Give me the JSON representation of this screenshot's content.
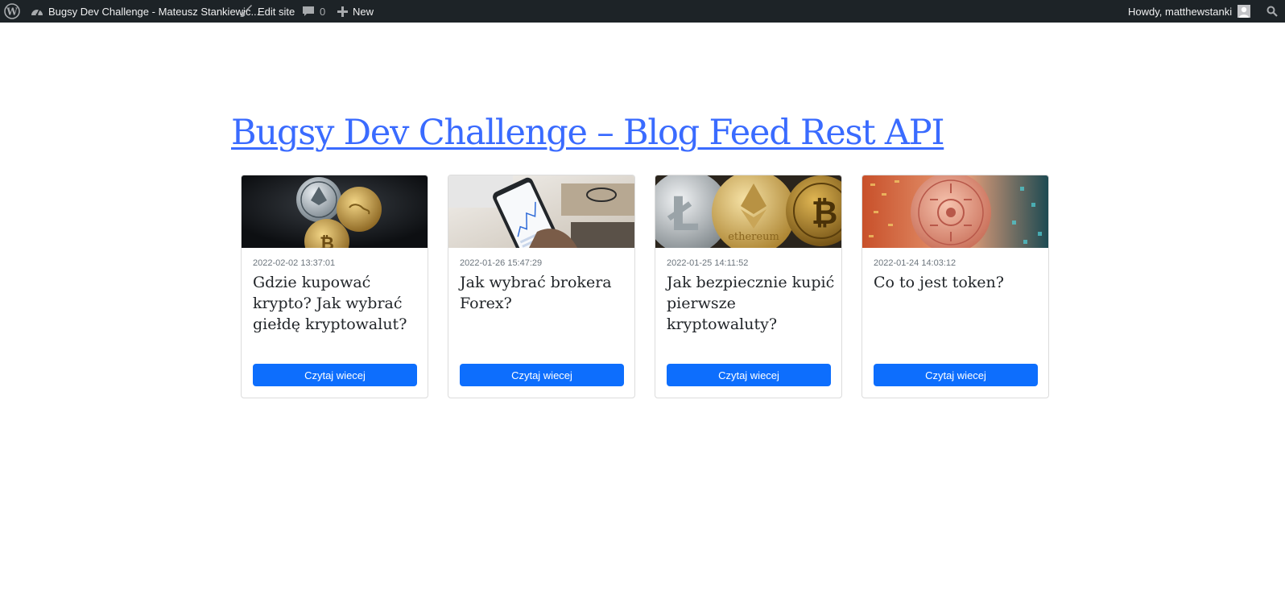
{
  "admin_bar": {
    "wp_logo_icon": "wordpress-logo-icon",
    "site_icon": "dashboard-icon",
    "site_name": "Bugsy Dev Challenge - Mateusz Stankiewic...",
    "edit_icon": "brush-icon",
    "edit_label": "Edit site",
    "comments_icon": "comment-icon",
    "comments_count": "0",
    "new_icon": "plus-icon",
    "new_label": "New",
    "greeting": "Howdy, matthewstanki",
    "search_icon": "search-icon",
    "colors": {
      "background": "#1d2327",
      "text": "#f0f0f1"
    }
  },
  "page": {
    "title": "Bugsy Dev Challenge – Blog Feed Rest API",
    "title_color": "#3a6bff"
  },
  "posts": [
    {
      "date": "2022-02-02 13:37:01",
      "title": "Gdzie kupować krypto? Jak wybrać giełdę kryptowalut?",
      "button": "Czytaj wiecej",
      "image": "crypto-coins-dark-image"
    },
    {
      "date": "2022-01-26 15:47:29",
      "title": "Jak wybrać brokera Forex?",
      "button": "Czytaj wiecej",
      "image": "smartphone-trading-chart-image"
    },
    {
      "date": "2022-01-25 14:11:52",
      "title": "Jak bezpiecznie kupić pierwsze kryptowaluty?",
      "button": "Czytaj wiecej",
      "image": "crypto-coins-gold-image"
    },
    {
      "date": "2022-01-24 14:03:12",
      "title": "Co to jest token?",
      "button": "Czytaj wiecej",
      "image": "digital-token-circuit-image"
    }
  ],
  "colors": {
    "button": "#0d6efd",
    "date_text": "#6c757d"
  }
}
